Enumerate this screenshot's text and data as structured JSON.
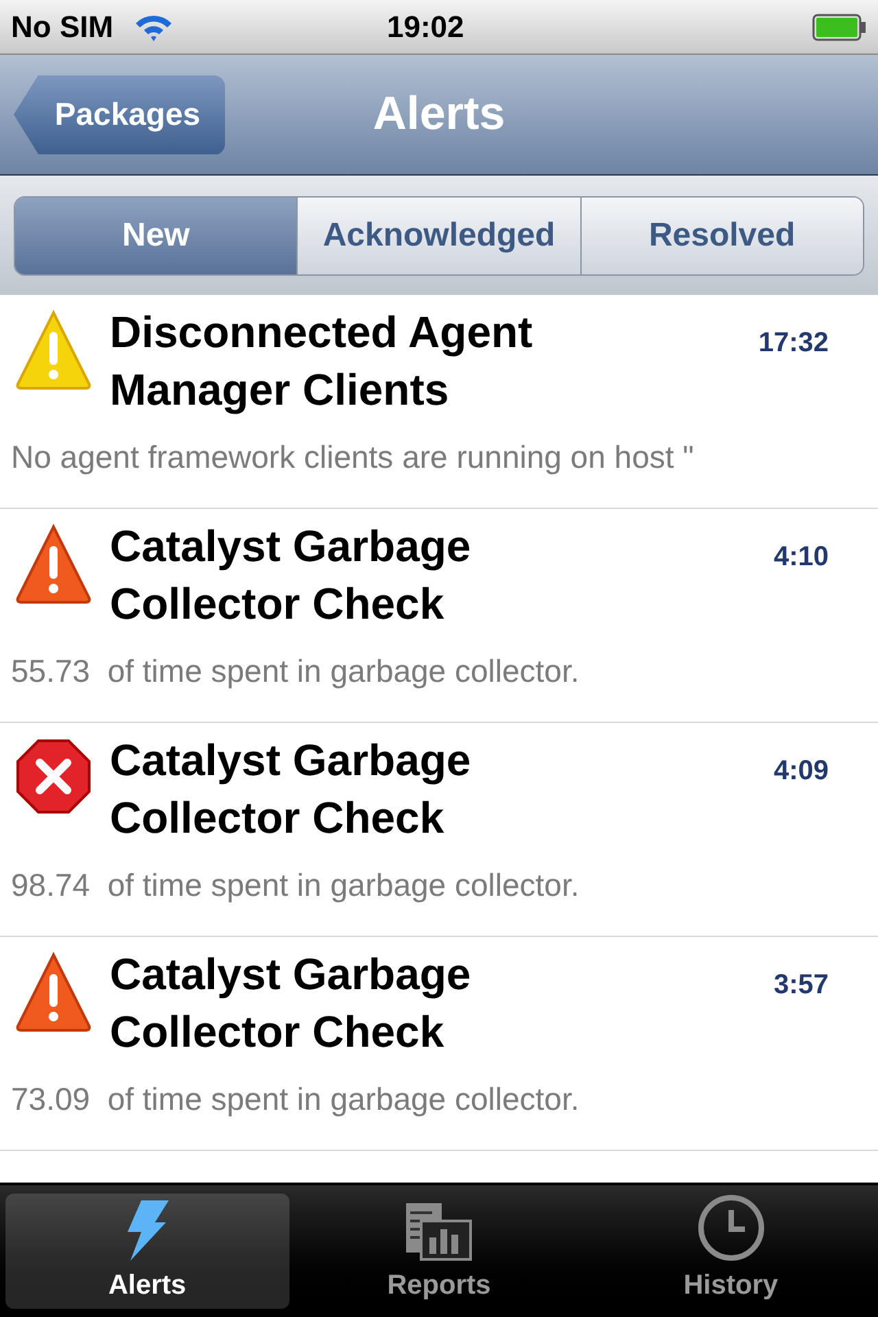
{
  "status_bar": {
    "carrier": "No SIM",
    "time": "19:02"
  },
  "nav_bar": {
    "back": "Packages",
    "title": "Alerts"
  },
  "segments": [
    {
      "label": "New",
      "selected": true
    },
    {
      "label": "Acknowledged",
      "selected": false
    },
    {
      "label": "Resolved",
      "selected": false
    }
  ],
  "alerts": [
    {
      "kind": "warning",
      "title": "Disconnected Agent Manager Clients",
      "time": "17:32",
      "message": "No agent framework clients are running on host \""
    },
    {
      "kind": "major",
      "title": "Catalyst Garbage Collector Check",
      "time": "4:10",
      "message": "55.73  of time spent in garbage collector."
    },
    {
      "kind": "critical",
      "title": "Catalyst Garbage Collector Check",
      "time": "4:09",
      "message": "98.74  of time spent in garbage collector."
    },
    {
      "kind": "major",
      "title": "Catalyst Garbage Collector Check",
      "time": "3:57",
      "message": "73.09  of time spent in garbage collector."
    }
  ],
  "tab_bar": [
    {
      "label": "Alerts",
      "kind": "bolt",
      "selected": true
    },
    {
      "label": "Reports",
      "kind": "reports",
      "selected": false
    },
    {
      "label": "History",
      "kind": "clock",
      "selected": false
    }
  ]
}
